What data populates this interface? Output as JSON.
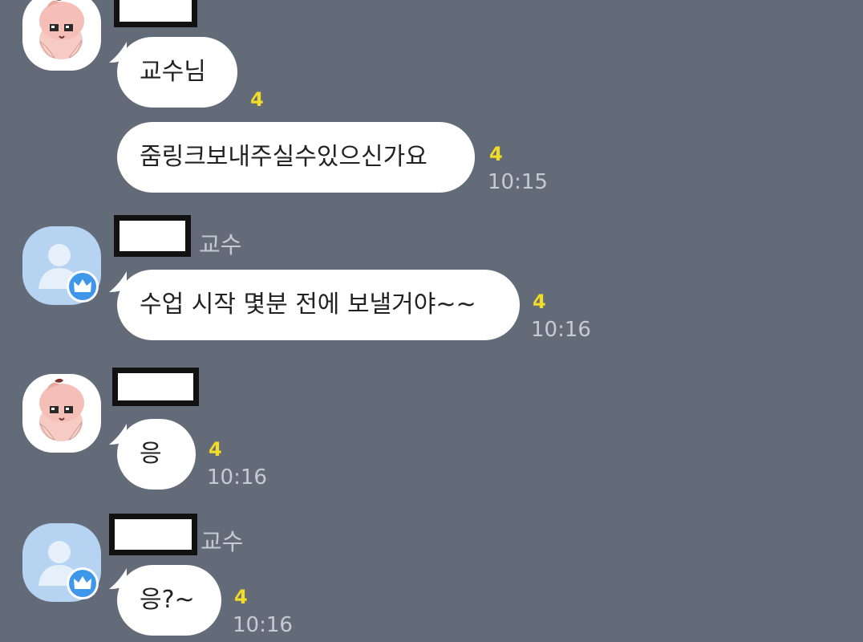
{
  "chat": {
    "messages": [
      {
        "text": "교수님",
        "unread": "4"
      },
      {
        "text": "줌링크보내주실수있으신가요",
        "unread": "4",
        "time": "10:15"
      },
      {
        "text": "수업 시작 몇분 전에 보낼거야~~",
        "unread": "4",
        "time": "10:16",
        "role": "교수"
      },
      {
        "text": "응",
        "unread": "4",
        "time": "10:16"
      },
      {
        "text": "응?~",
        "unread": "4",
        "time": "10:16",
        "role": "교수"
      }
    ]
  },
  "colors": {
    "background": "#646b78",
    "bubble": "#ffffff",
    "unread_count": "#f3dc28",
    "timestamp": "#c6cad2",
    "default_avatar": "#b7d3f2",
    "crown_badge": "#3f97ea"
  },
  "icons": {
    "student_avatar": "peach-character-icon",
    "professor_avatar": "default-profile-icon",
    "professor_badge": "crown-icon"
  }
}
